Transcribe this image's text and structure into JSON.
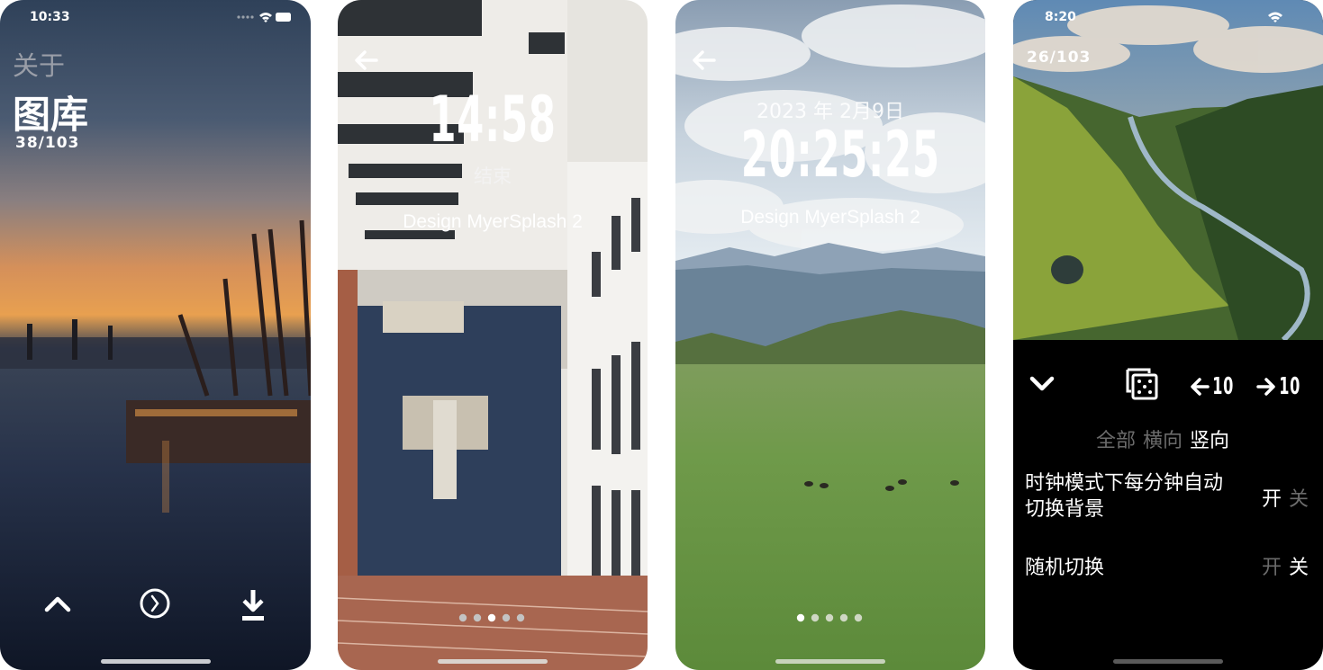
{
  "screens": [
    {
      "status_time": "10:33",
      "about": "关于",
      "title": "图库",
      "counter": "38/103"
    },
    {
      "clock": "14:58",
      "end_label": "结束",
      "subtitle": "Design MyerSplash 2"
    },
    {
      "date": "2023 年 2月9日",
      "clock": "20:25:25",
      "subtitle": "Design MyerSplash 2"
    },
    {
      "status_time": "8:20",
      "counter": "26/103",
      "skip_back": "10",
      "skip_forward": "10",
      "filter": {
        "all": "全部",
        "landscape": "横向",
        "portrait": "竖向"
      },
      "setting1": {
        "label_line1": "时钟模式下每分钟自动",
        "label_line2": "切换背景",
        "on": "开",
        "off": "关"
      },
      "setting2": {
        "label": "随机切换",
        "on": "开",
        "off": "关"
      }
    }
  ]
}
